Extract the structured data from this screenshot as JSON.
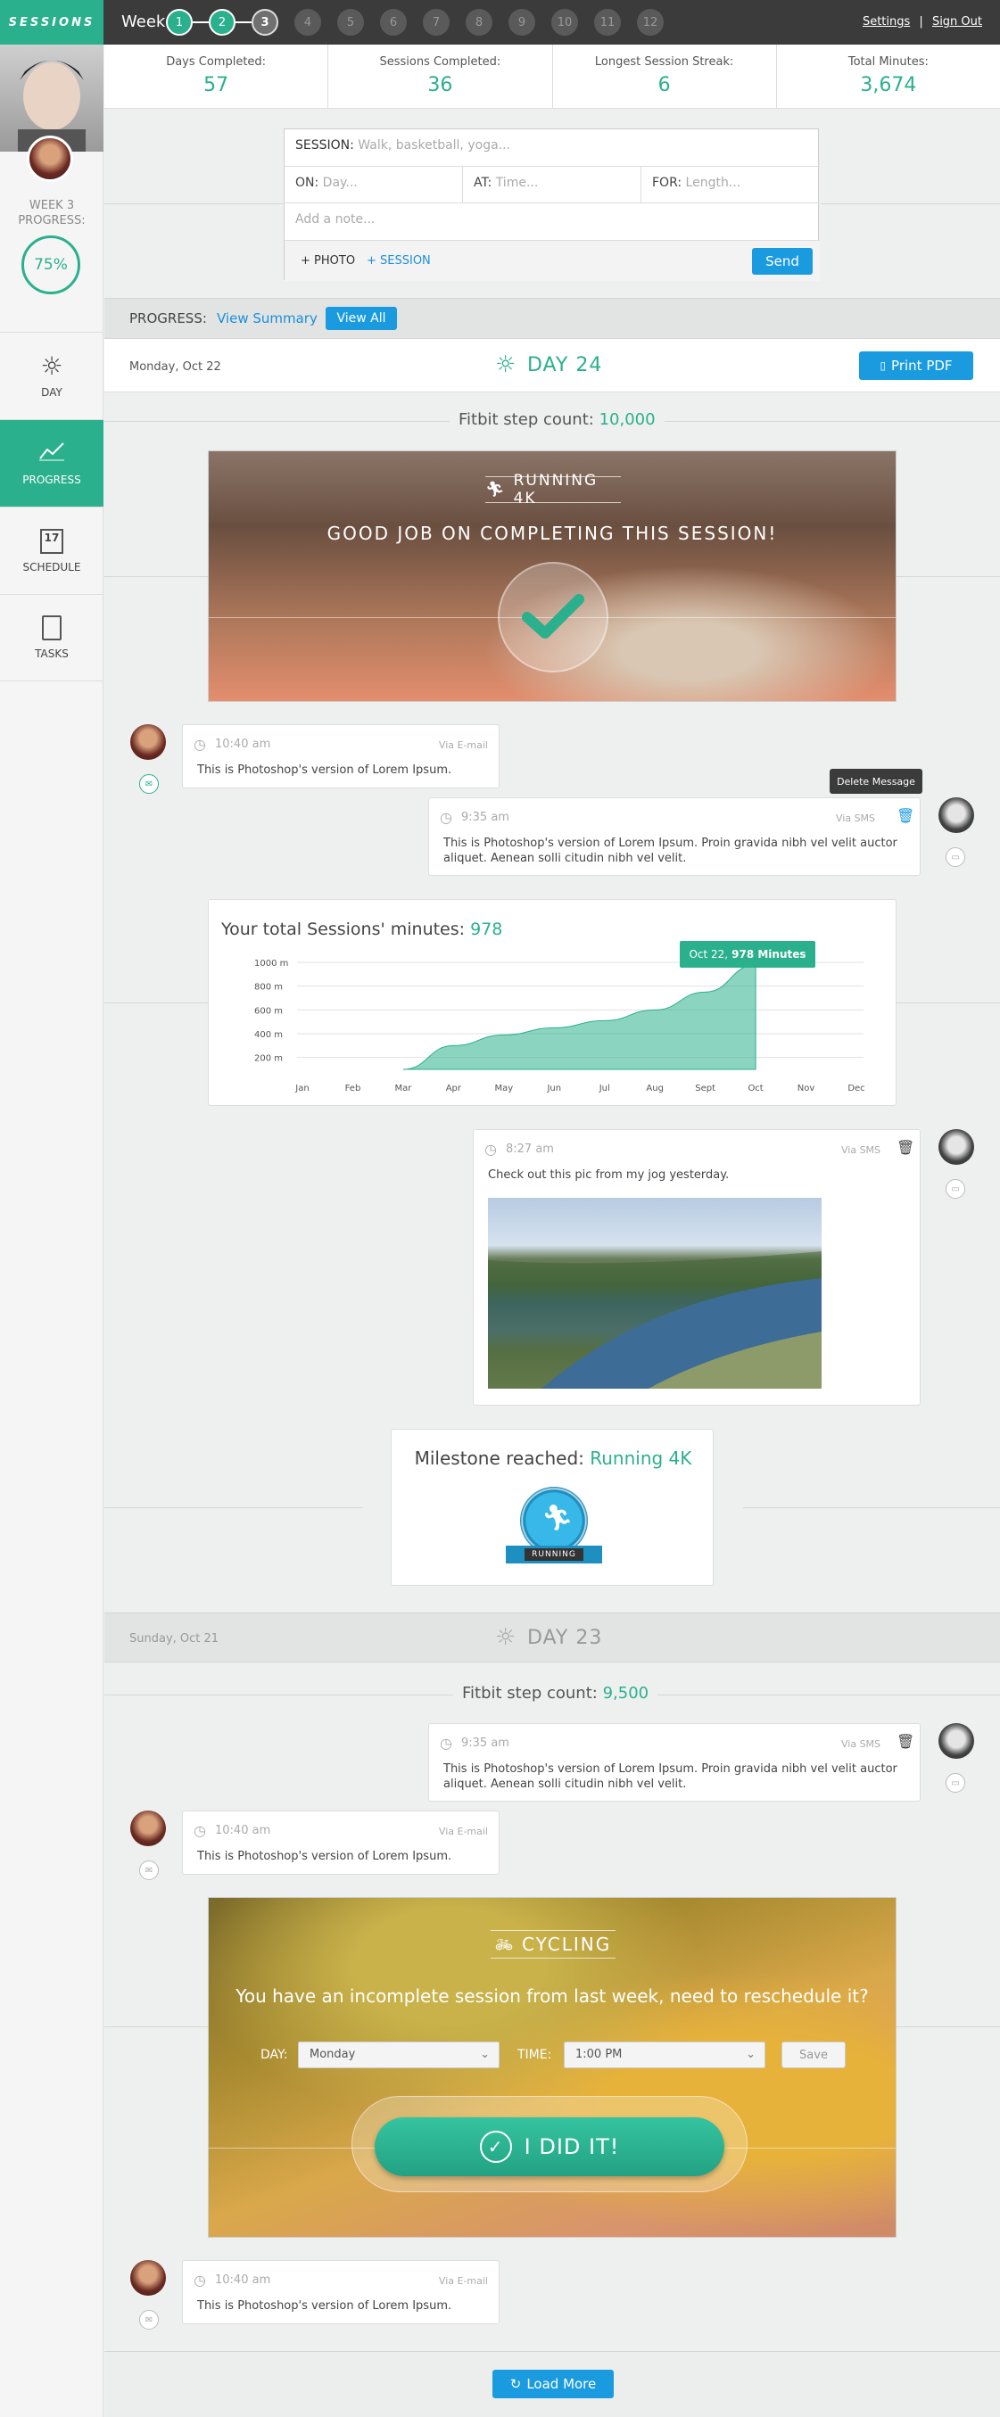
{
  "app": {
    "logo": "SESSIONS"
  },
  "topbar": {
    "week_label": "Week",
    "weeks": [
      "1",
      "2",
      "3",
      "4",
      "5",
      "6",
      "7",
      "8",
      "9",
      "10",
      "11",
      "12"
    ],
    "settings": "Settings",
    "separator": "|",
    "signout": "Sign Out"
  },
  "sidebar": {
    "week_progress_line1": "WEEK 3",
    "week_progress_line2": "PROGRESS:",
    "progress_value": "75%",
    "progress_fraction": 0.75,
    "nav": [
      {
        "label": "DAY",
        "icon": "sun-icon"
      },
      {
        "label": "PROGRESS",
        "icon": "chart-icon"
      },
      {
        "label": "SCHEDULE",
        "icon": "calendar-icon",
        "calendar_day": "17"
      },
      {
        "label": "TASKS",
        "icon": "clipboard-icon"
      }
    ]
  },
  "stats": [
    {
      "label": "Days Completed:",
      "value": "57"
    },
    {
      "label": "Sessions Completed:",
      "value": "36"
    },
    {
      "label": "Longest Session Streak:",
      "value": "6"
    },
    {
      "label": "Total Minutes:",
      "value": "3,674"
    }
  ],
  "composer": {
    "session_label": "SESSION:",
    "session_placeholder": "Walk, basketball, yoga...",
    "on_label": "ON:",
    "on_placeholder": "Day...",
    "at_label": "AT:",
    "at_placeholder": "Time...",
    "for_label": "FOR:",
    "for_placeholder": "Length...",
    "note_placeholder": "Add a note...",
    "photo": "+ PHOTO",
    "session": "+ SESSION",
    "send": "Send"
  },
  "progress_bar": {
    "label": "PROGRESS:",
    "view_summary": "View Summary",
    "view_all": "View All"
  },
  "day24": {
    "date": "Monday, Oct 22",
    "title": "DAY 24",
    "print": "Print PDF",
    "fitbit_label": "Fitbit step count:",
    "fitbit_value": "10,000",
    "hero_tag": "RUNNING 4K",
    "hero_text": "GOOD JOB ON COMPLETING THIS SESSION!",
    "msg1": {
      "time": "10:40 am",
      "via": "Via E-mail",
      "text": "This is Photoshop's version  of Lorem Ipsum."
    },
    "tooltip": "Delete Message",
    "msg2": {
      "time": "9:35 am",
      "via": "Via SMS",
      "text": "This is Photoshop's version  of Lorem Ipsum. Proin gravida nibh vel velit auctor aliquet. Aenean solli citudin nibh vel velit."
    },
    "chart_title": "Your total Sessions' minutes:",
    "chart_total": "978",
    "chart_tooltip_date": "Oct 22,",
    "chart_tooltip_value": "978 Minutes",
    "msg3": {
      "time": "8:27 am",
      "via": "Via SMS",
      "text": "Check out this pic from my jog yesterday."
    },
    "milestone_label": "Milestone reached:",
    "milestone_value": "Running 4K",
    "badge_text": "RUNNING"
  },
  "chart_data": {
    "type": "area",
    "title": "Your total Sessions' minutes: 978",
    "categories": [
      "Jan",
      "Feb",
      "Mar",
      "Apr",
      "May",
      "Jun",
      "Jul",
      "Aug",
      "Sept",
      "Oct",
      "Nov",
      "Dec"
    ],
    "series": [
      {
        "values": [
          null,
          null,
          100,
          300,
          390,
          450,
          510,
          600,
          750,
          978,
          null,
          null
        ]
      }
    ],
    "yticks": [
      "200 m",
      "400 m",
      "600 m",
      "800 m",
      "1000 m"
    ],
    "ylim": [
      100,
      1000
    ],
    "grid": true,
    "color": "#2bb08d"
  },
  "day23": {
    "date": "Sunday, Oct 21",
    "title": "DAY 23",
    "fitbit_label": "Fitbit step count:",
    "fitbit_value": "9,500",
    "msg1": {
      "time": "9:35 am",
      "via": "Via SMS",
      "text": "This is Photoshop's version  of Lorem Ipsum. Proin gravida nibh vel velit auctor aliquet. Aenean solli citudin nibh vel velit."
    },
    "msg2": {
      "time": "10:40 am",
      "via": "Via E-mail",
      "text": "This is Photoshop's version  of Lorem Ipsum."
    },
    "hero_tag": "CYCLING",
    "hero_text": "You have an incomplete session from last week, need to reschedule it?",
    "day_label": "DAY:",
    "day_value": "Monday",
    "time_label": "TIME:",
    "time_value": "1:00 PM",
    "save": "Save",
    "did_it": "I DID IT!",
    "msg3": {
      "time": "10:40 am",
      "via": "Via E-mail",
      "text": "This is Photoshop's version  of Lorem Ipsum."
    }
  },
  "load_more": "Load More",
  "colors": {
    "accent": "#2bb08d",
    "blue": "#1a9be0",
    "topbar": "#3b3b3b"
  }
}
